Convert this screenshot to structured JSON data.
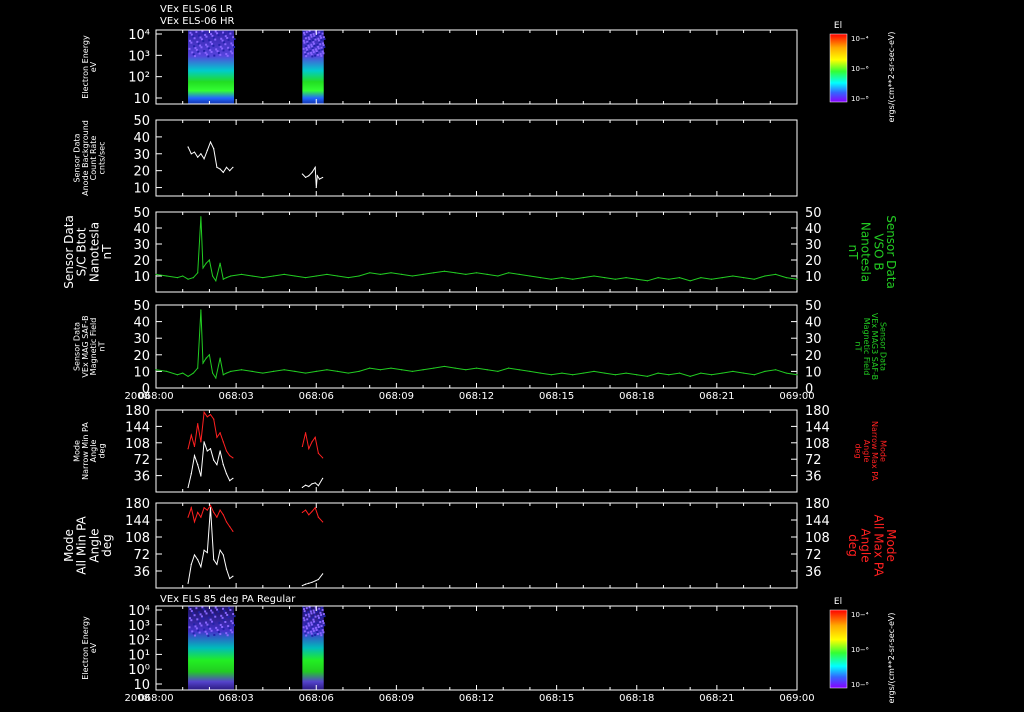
{
  "header": {
    "line1": "VEx ELS-06 LR",
    "line2": "VEx ELS-06 HR",
    "bottom_title": "VEx ELS 85 deg PA Regular"
  },
  "time_axis": {
    "year_label": "2008",
    "ticks": [
      "068:00",
      "068:03",
      "068:06",
      "068:09",
      "068:12",
      "068:15",
      "068:18",
      "068:21",
      "069:00"
    ],
    "range_minutes": [
      0,
      60
    ]
  },
  "colorbar": {
    "title": "El",
    "labels": [
      "10−⁴",
      "10−⁶",
      "10−⁸"
    ],
    "unit": "ergs/(cm**2-sr-sec-eV)"
  },
  "colors": {
    "white": "#ffffff",
    "green": "#22cc22",
    "red": "#ff2020",
    "background": "#000000"
  },
  "chart_data": [
    {
      "id": "els-spectrogram-top",
      "type": "heatmap",
      "ylabel": [
        "Electron Energy",
        "eV"
      ],
      "yticks": [
        "10⁴",
        "10³",
        "10²",
        "10"
      ],
      "yscale": "log",
      "data_intervals_min": [
        [
          3.0,
          7.3
        ],
        [
          13.7,
          15.7
        ]
      ]
    },
    {
      "id": "anode-background",
      "type": "line",
      "ylabel": [
        "Sensor Data",
        "Anode Background",
        "Count Rate",
        "cnts/sec"
      ],
      "yticks": [
        "50",
        "40",
        "30",
        "20",
        "10"
      ],
      "ylim": [
        5,
        50
      ],
      "series": [
        {
          "color": "#ffffff",
          "x": [
            3.0,
            3.3,
            3.6,
            3.9,
            4.2,
            4.5,
            4.8,
            5.1,
            5.4,
            5.7,
            6.0,
            6.3,
            6.6,
            6.9,
            7.2,
            13.7,
            14.0,
            14.3,
            14.6,
            14.9,
            15.0,
            15.1,
            15.3,
            15.6
          ],
          "y": [
            34,
            30,
            31,
            28,
            30,
            27,
            32,
            37,
            33,
            22,
            21,
            19,
            22,
            20,
            22,
            18,
            16,
            17,
            19,
            22,
            10,
            17,
            15,
            16
          ]
        }
      ]
    },
    {
      "id": "sc-bmag",
      "type": "line",
      "ylabel": [
        "Sensor Data",
        "S/C Btot",
        "Nanotesla",
        "nT"
      ],
      "ylabel_right": [
        "Sensor Data",
        "VSO B",
        "Nanotesla",
        "nT"
      ],
      "yticks": [
        "50",
        "40",
        "30",
        "20",
        "10"
      ],
      "ylim": [
        0,
        50
      ],
      "series": [
        {
          "color": "#22cc22",
          "x": [
            0,
            1,
            2,
            2.5,
            3,
            3.5,
            3.9,
            4.2,
            4.4,
            4.7,
            5.0,
            5.3,
            5.6,
            6.0,
            6.3,
            6.6,
            7,
            8,
            9,
            10,
            11,
            12,
            13,
            14,
            15,
            16,
            17,
            18,
            19,
            20,
            21,
            22,
            23,
            24,
            25,
            26,
            27,
            28,
            29,
            30,
            31,
            32,
            33,
            34,
            35,
            36,
            37,
            38,
            39,
            40,
            41,
            42,
            43,
            44,
            45,
            46,
            47,
            48,
            49,
            50,
            51,
            52,
            53,
            54,
            55,
            56,
            57,
            58,
            59,
            60
          ],
          "y": [
            11,
            10,
            9,
            10,
            8,
            9,
            12,
            47,
            15,
            18,
            20,
            10,
            7,
            18,
            8,
            9,
            10,
            11,
            10,
            9,
            10,
            11,
            10,
            9,
            10,
            11,
            10,
            9,
            10,
            12,
            11,
            12,
            11,
            10,
            11,
            12,
            13,
            12,
            11,
            12,
            11,
            10,
            12,
            11,
            10,
            9,
            8,
            9,
            8,
            9,
            10,
            9,
            8,
            9,
            8,
            7,
            9,
            8,
            9,
            7,
            9,
            8,
            9,
            10,
            9,
            8,
            10,
            11,
            9,
            8
          ]
        }
      ]
    },
    {
      "id": "mag-saf",
      "type": "line",
      "ylabel": [
        "Sensor Data",
        "VEx MAG SAF-B",
        "Magnetic Field",
        "nT"
      ],
      "ylabel_right": [
        "Sensor Data",
        "VEx MAG3 SAF-B",
        "Magnetic Field",
        "nT"
      ],
      "yticks": [
        "50",
        "40",
        "30",
        "20",
        "10",
        "0"
      ],
      "ylim": [
        0,
        50
      ],
      "series": [
        {
          "color": "#22cc22",
          "x": [
            0,
            1,
            2,
            2.5,
            3,
            3.5,
            3.9,
            4.2,
            4.4,
            4.7,
            5.0,
            5.3,
            5.6,
            6.0,
            6.3,
            6.6,
            7,
            8,
            9,
            10,
            11,
            12,
            13,
            14,
            15,
            16,
            17,
            18,
            19,
            20,
            21,
            22,
            23,
            24,
            25,
            26,
            27,
            28,
            29,
            30,
            31,
            32,
            33,
            34,
            35,
            36,
            37,
            38,
            39,
            40,
            41,
            42,
            43,
            44,
            45,
            46,
            47,
            48,
            49,
            50,
            51,
            52,
            53,
            54,
            55,
            56,
            57,
            58,
            59,
            60
          ],
          "y": [
            11,
            10,
            8,
            9,
            7,
            9,
            12,
            47,
            15,
            18,
            20,
            9,
            6,
            18,
            8,
            9,
            10,
            11,
            10,
            9,
            10,
            11,
            10,
            9,
            10,
            11,
            10,
            9,
            10,
            12,
            11,
            12,
            11,
            10,
            11,
            12,
            13,
            12,
            11,
            12,
            11,
            10,
            12,
            11,
            10,
            9,
            8,
            9,
            8,
            9,
            10,
            9,
            8,
            9,
            8,
            7,
            9,
            8,
            9,
            7,
            9,
            8,
            9,
            10,
            9,
            8,
            10,
            11,
            9,
            8
          ]
        }
      ]
    },
    {
      "id": "narrow-pa",
      "type": "line",
      "ylabel": [
        "Mode",
        "Narrow Min PA",
        "Angle",
        "deg"
      ],
      "ylabel_right": [
        "Mode",
        "Narrow Max PA",
        "Angle",
        "deg"
      ],
      "yticks": [
        "180",
        "144",
        "108",
        "72",
        "36"
      ],
      "ylim": [
        0,
        180
      ],
      "series": [
        {
          "color": "#ff2020",
          "x": [
            3.0,
            3.3,
            3.6,
            3.9,
            4.2,
            4.5,
            4.8,
            5.1,
            5.4,
            5.7,
            6.0,
            6.3,
            6.6,
            6.9,
            7.2,
            13.7,
            14.0,
            14.3,
            14.6,
            14.9,
            15.2,
            15.6
          ],
          "y": [
            95,
            125,
            100,
            150,
            110,
            175,
            165,
            170,
            160,
            120,
            130,
            110,
            90,
            80,
            75,
            100,
            130,
            95,
            110,
            120,
            85,
            75
          ]
        },
        {
          "color": "#ffffff",
          "x": [
            3.0,
            3.3,
            3.6,
            3.9,
            4.2,
            4.5,
            4.8,
            5.1,
            5.4,
            5.7,
            6.0,
            6.3,
            6.6,
            6.9,
            7.2,
            13.7,
            14.0,
            14.3,
            14.6,
            14.9,
            15.2,
            15.6
          ],
          "y": [
            10,
            40,
            80,
            60,
            35,
            110,
            90,
            95,
            70,
            60,
            90,
            60,
            40,
            25,
            30,
            10,
            15,
            12,
            18,
            20,
            14,
            30
          ]
        }
      ]
    },
    {
      "id": "all-pa",
      "type": "line",
      "ylabel": [
        "Mode",
        "All Min PA",
        "Angle",
        "deg"
      ],
      "ylabel_right": [
        "Mode",
        "All Max PA",
        "Angle",
        "deg"
      ],
      "yticks": [
        "180",
        "144",
        "108",
        "72",
        "36"
      ],
      "ylim": [
        0,
        180
      ],
      "series": [
        {
          "color": "#ff2020",
          "x": [
            3.0,
            3.3,
            3.6,
            3.9,
            4.2,
            4.5,
            4.8,
            5.1,
            5.4,
            5.7,
            6.0,
            6.3,
            6.6,
            6.9,
            7.2,
            13.7,
            14.0,
            14.3,
            14.6,
            14.9,
            15.2,
            15.6
          ],
          "y": [
            150,
            170,
            140,
            160,
            150,
            170,
            165,
            175,
            160,
            150,
            165,
            155,
            140,
            130,
            120,
            160,
            165,
            155,
            162,
            170,
            150,
            140
          ]
        },
        {
          "color": "#ffffff",
          "x": [
            3.0,
            3.3,
            3.6,
            3.9,
            4.2,
            4.5,
            4.8,
            5.1,
            5.4,
            5.7,
            6.0,
            6.3,
            6.6,
            6.9,
            7.2,
            13.7,
            14.0,
            14.3,
            14.6,
            14.9,
            15.2,
            15.6
          ],
          "y": [
            10,
            50,
            70,
            60,
            45,
            80,
            75,
            170,
            60,
            50,
            80,
            70,
            40,
            20,
            25,
            5,
            8,
            10,
            12,
            15,
            18,
            30
          ]
        }
      ]
    },
    {
      "id": "els-spectrogram-bottom",
      "type": "heatmap",
      "ylabel": [
        "Electron Energy",
        "eV"
      ],
      "yticks": [
        "10⁴",
        "10³",
        "10²",
        "10¹",
        "10⁰",
        "10"
      ],
      "yscale": "log",
      "data_intervals_min": [
        [
          3.0,
          7.3
        ],
        [
          13.7,
          15.7
        ]
      ]
    }
  ]
}
